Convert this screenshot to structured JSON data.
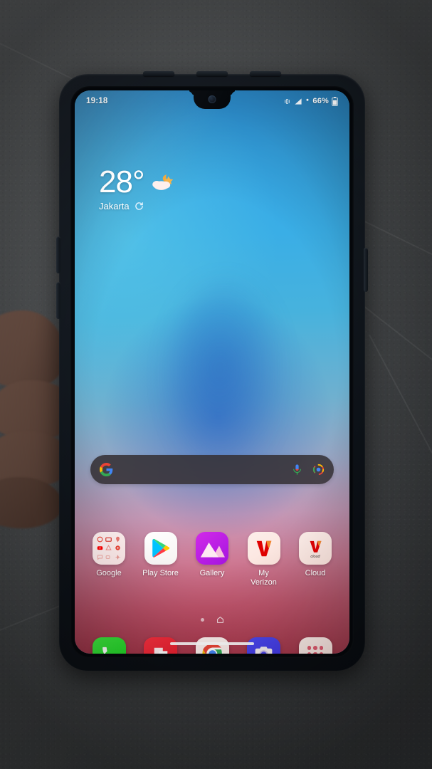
{
  "scene": {
    "description": "Android phone in black rugged case held in hand over gray tile floor",
    "background_color": "#55585a"
  },
  "statusbar": {
    "time": "19:18",
    "icons": [
      "vibrate-icon",
      "signal-icon",
      "volte-icon"
    ],
    "battery_percent": "66%",
    "battery_icon": "battery-icon"
  },
  "weather": {
    "temperature": "28°",
    "city": "Jakarta",
    "condition_icon": "partly-cloudy-night-icon",
    "refresh_icon": "refresh-icon"
  },
  "search": {
    "logo": "google-g-icon",
    "placeholder": "",
    "value": "",
    "mic_icon": "microphone-icon",
    "lens_icon": "google-lens-icon",
    "background_color": "#343034"
  },
  "apps": [
    {
      "label": "Google",
      "icon": "google-folder-icon",
      "type": "folder"
    },
    {
      "label": "Play Store",
      "icon": "play-store-icon",
      "type": "app"
    },
    {
      "label": "Gallery",
      "icon": "gallery-icon",
      "type": "app"
    },
    {
      "label": "My\nVerizon",
      "label_line1": "My",
      "label_line2": "Verizon",
      "icon": "my-verizon-icon",
      "type": "app"
    },
    {
      "label": "Cloud",
      "icon": "verizon-cloud-icon",
      "badge_text": "cloud",
      "type": "app"
    }
  ],
  "page_indicator": {
    "dots": 1,
    "home_icon": "home-icon",
    "active_page": 1
  },
  "dock": [
    {
      "label": "Phone",
      "icon": "phone-icon",
      "color": "#22d22a"
    },
    {
      "label": "Messages",
      "icon": "messages-icon",
      "color": "#ef2433"
    },
    {
      "label": "Chrome",
      "icon": "chrome-icon",
      "color": "#ffffff"
    },
    {
      "label": "Camera",
      "icon": "camera-icon",
      "color": "#403ae8"
    },
    {
      "label": "App Drawer",
      "icon": "app-drawer-icon",
      "color": "#fbe6e0"
    }
  ],
  "gesture_bar": {
    "visible": true
  },
  "wallpaper": {
    "type": "gradient",
    "top_color": "#2f97e0",
    "mid_color": "#9aa6c4",
    "bottom_color": "#cb4058"
  }
}
